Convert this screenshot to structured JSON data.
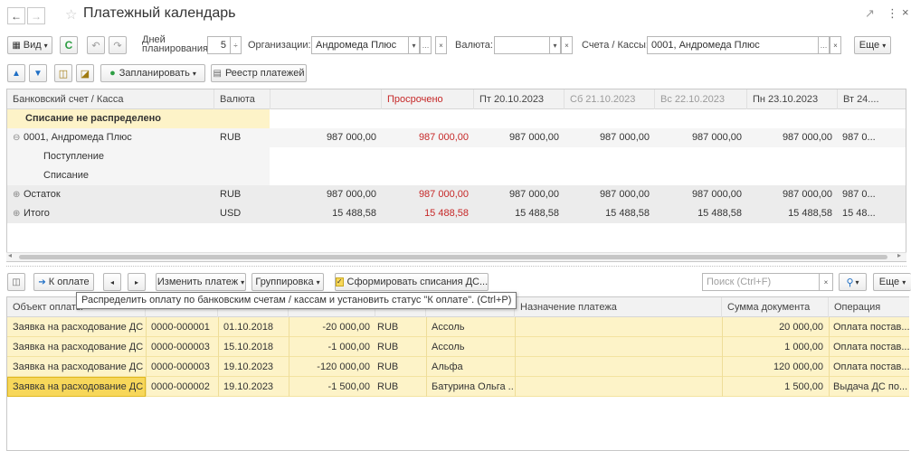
{
  "window": {
    "title": "Платежный календарь",
    "link_icon": "link-icon",
    "more_icon": "⋮",
    "close_icon": "×"
  },
  "toolbar1": {
    "view_label": "Вид",
    "days_label_line1": "Дней",
    "days_label_line2": "планирования:",
    "days_value": "5",
    "org_label": "Организации:",
    "org_value": "Андромеда Плюс",
    "currency_label": "Валюта:",
    "currency_value": "",
    "accounts_label": "Счета / Кассы:",
    "accounts_value": "0001, Андромеда Плюс",
    "more_label": "Еще"
  },
  "toolbar2": {
    "plan_label": "Запланировать",
    "registry_label": "Реестр платежей"
  },
  "grid1": {
    "columns": [
      "Банковский счет / Касса",
      "Валюта",
      "",
      "Просрочено",
      "Пт 20.10.2023",
      "Сб 21.10.2023",
      "Вс 22.10.2023",
      "Пн 23.10.2023",
      "Вт 24...."
    ],
    "rows": [
      {
        "name": "Списание не распределено",
        "currency": "",
        "overdue": "",
        "d1": "",
        "d2": "",
        "d3": "",
        "d4": "",
        "d5": ""
      },
      {
        "name": "0001, Андромеда Плюс",
        "currency": "RUB",
        "total": "987 000,00",
        "overdue": "987 000,00",
        "d1": "987 000,00",
        "d2": "987 000,00",
        "d3": "987 000,00",
        "d4": "987 000,00",
        "d5": "987 0..."
      },
      {
        "name": "Поступление",
        "currency": "",
        "total": "",
        "overdue": "",
        "d1": "",
        "d2": "",
        "d3": "",
        "d4": "",
        "d5": ""
      },
      {
        "name": "Списание",
        "currency": "",
        "total": "",
        "overdue": "",
        "d1": "",
        "d2": "",
        "d3": "",
        "d4": "",
        "d5": ""
      },
      {
        "name": "Остаток",
        "currency": "RUB",
        "total": "987 000,00",
        "overdue": "987 000,00",
        "d1": "987 000,00",
        "d2": "987 000,00",
        "d3": "987 000,00",
        "d4": "987 000,00",
        "d5": "987 0..."
      },
      {
        "name": "Итого",
        "currency": "USD",
        "total": "15 488,58",
        "overdue": "15 488,58",
        "d1": "15 488,58",
        "d2": "15 488,58",
        "d3": "15 488,58",
        "d4": "15 488,58",
        "d5": "15 48..."
      }
    ]
  },
  "toolbar3": {
    "to_payment_label": "К оплате",
    "change_payment_label": "Изменить платеж",
    "grouping_label": "Группировка",
    "form_writeoffs_label": "Сформировать списания ДС...",
    "search_placeholder": "Поиск (Ctrl+F)",
    "more_label": "Еще"
  },
  "tooltip": "Распределить оплату по банковским счетам / кассам и установить статус \"К оплате\". (Ctrl+P)",
  "grid2": {
    "columns": [
      "Объект оплаты",
      "",
      "",
      "",
      "",
      "",
      "Назначение платежа",
      "Сумма документа",
      "Операция"
    ],
    "rows": [
      {
        "object": "Заявка на расходование ДС",
        "number": "0000-000001",
        "date": "01.10.2018",
        "amount": "-20 000,00",
        "currency": "RUB",
        "counterparty": "Ассоль",
        "purpose": "",
        "doc_sum": "20 000,00",
        "operation": "Оплата постав..."
      },
      {
        "object": "Заявка на расходование ДС",
        "number": "0000-000003",
        "date": "15.10.2018",
        "amount": "-1 000,00",
        "currency": "RUB",
        "counterparty": "Ассоль",
        "purpose": "",
        "doc_sum": "1 000,00",
        "operation": "Оплата постав..."
      },
      {
        "object": "Заявка на расходование ДС",
        "number": "0000-000003",
        "date": "19.10.2023",
        "amount": "-120 000,00",
        "currency": "RUB",
        "counterparty": "Альфа",
        "purpose": "",
        "doc_sum": "120 000,00",
        "operation": "Оплата постав..."
      },
      {
        "object": "Заявка на расходование ДС",
        "number": "0000-000002",
        "date": "19.10.2023",
        "amount": "-1 500,00",
        "currency": "RUB",
        "counterparty": "Батурина Ольга ...",
        "purpose": "",
        "doc_sum": "1 500,00",
        "operation": "Выдача ДС по..."
      }
    ]
  },
  "colors": {
    "overdue_red": "#c62828",
    "highlight_yellow": "#fdf3c8",
    "selected_cell": "#f7d75a",
    "header_gray": "#f2f2f2"
  }
}
